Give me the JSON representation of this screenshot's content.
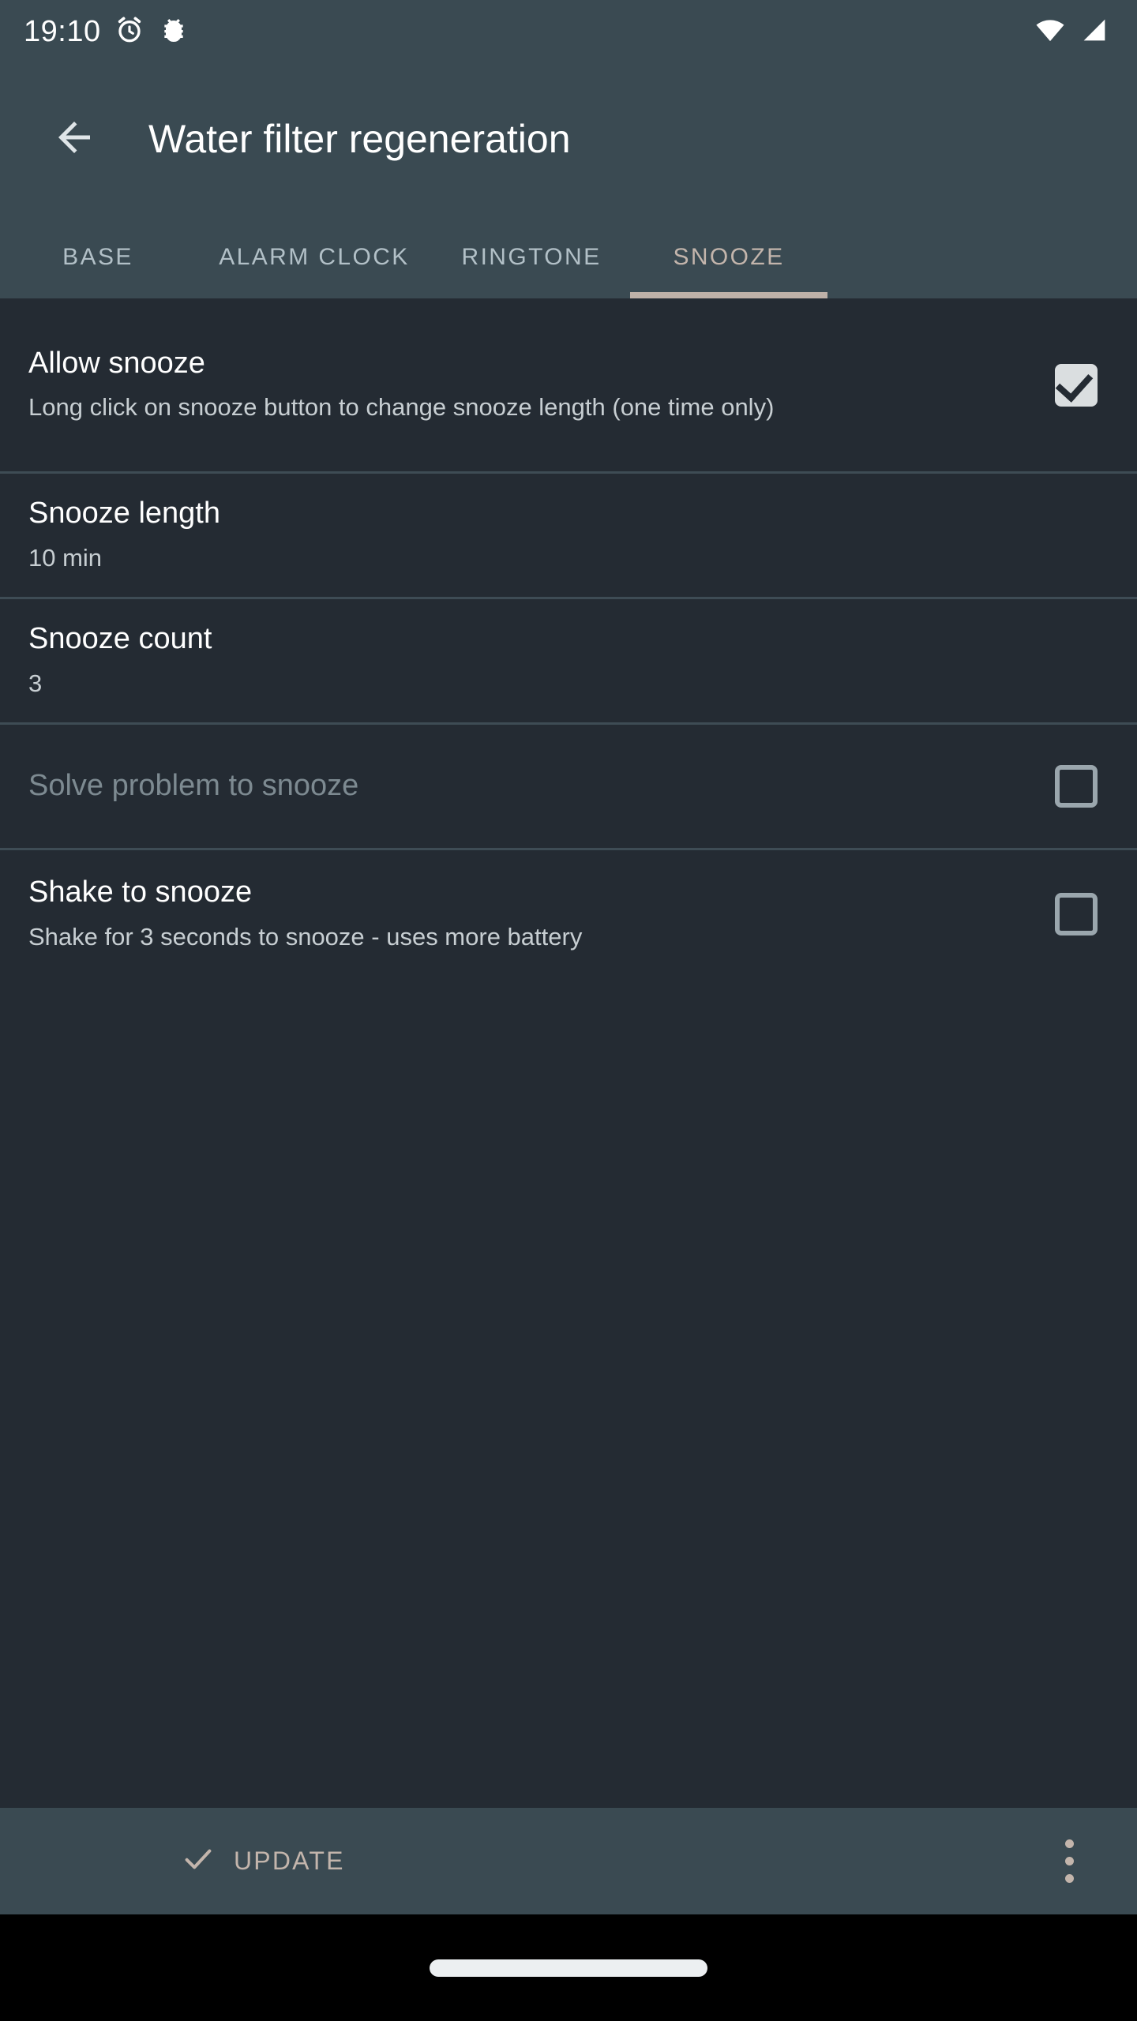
{
  "status_bar": {
    "clock": "19:10",
    "icons_left": [
      "alarm-clock-icon",
      "bug-report-icon"
    ],
    "icons_right": [
      "wifi-icon",
      "cellular-signal-icon"
    ]
  },
  "app_bar": {
    "back_icon": "arrow-back-icon",
    "title": "Water filter regeneration"
  },
  "tabs": {
    "active_index": 3,
    "items": [
      {
        "label": "BASE"
      },
      {
        "label": "ALARM CLOCK"
      },
      {
        "label": "RINGTONE"
      },
      {
        "label": "SNOOZE"
      }
    ]
  },
  "settings": {
    "rows": [
      {
        "title": "Allow snooze",
        "subtitle": "Long click on snooze button to change snooze length (one time only)",
        "control": "checkbox",
        "checked": true,
        "enabled": true
      },
      {
        "title": "Snooze length",
        "subtitle": "10 min",
        "control": "none",
        "checked": false,
        "enabled": true
      },
      {
        "title": "Snooze count",
        "subtitle": "3",
        "control": "none",
        "checked": false,
        "enabled": true
      },
      {
        "title": "Solve problem to snooze",
        "subtitle": "",
        "control": "checkbox",
        "checked": false,
        "enabled": false
      },
      {
        "title": "Shake to snooze",
        "subtitle": "Shake for 3 seconds to snooze - uses more battery",
        "control": "checkbox",
        "checked": false,
        "enabled": true
      }
    ]
  },
  "bottom_bar": {
    "update_label": "UPDATE",
    "update_icon": "check-icon",
    "overflow_icon": "more-vert-icon"
  },
  "colors": {
    "app_bar_bg": "#3a4a52",
    "content_bg": "#242b33",
    "accent": "#beb1a8",
    "divider": "#3e4c55",
    "tab_inactive": "#b2c0c7",
    "title_text": "#ffffff",
    "subtitle_text": "#c7ced2",
    "disabled_text": "#7d8a91"
  }
}
